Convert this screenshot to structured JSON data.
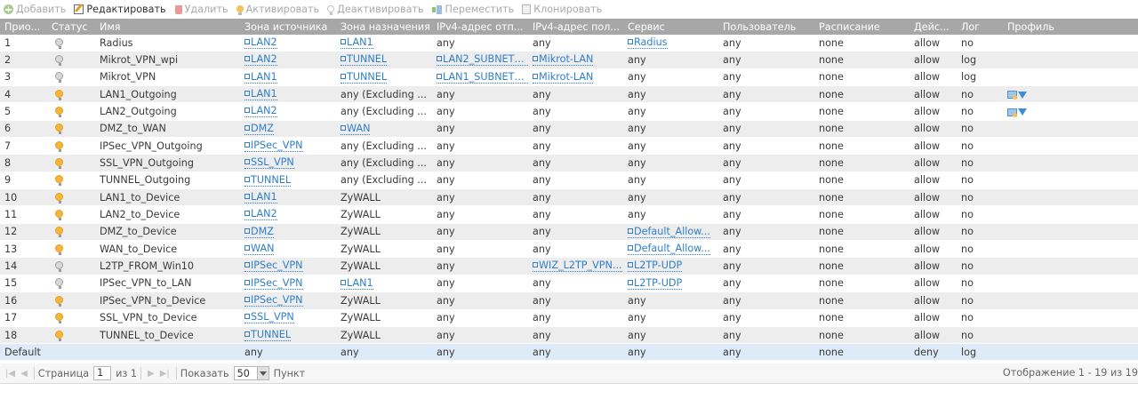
{
  "toolbar": {
    "add": "Добавить",
    "edit": "Редактировать",
    "delete": "Удалить",
    "activate": "Активировать",
    "deactivate": "Деактивировать",
    "move": "Переместить",
    "clone": "Клонировать"
  },
  "table": {
    "headers": [
      "Прио...",
      "Статус",
      "Имя",
      "Зона источника",
      "Зона назначения",
      "IPv4-адрес отп...",
      "IPv4-адрес пол...",
      "Сервис",
      "Пользователь",
      "Расписание",
      "Дейс...",
      "Лог",
      "Профиль"
    ],
    "rows": [
      {
        "prio": "1",
        "status": "off",
        "name": "Radius",
        "src": "LAN2",
        "src_link": true,
        "dst": "LAN1",
        "dst_link": true,
        "v4src": "any",
        "v4src_link": false,
        "v4dst": "any",
        "v4dst_link": false,
        "svc": "Radius",
        "svc_link": true,
        "user": "any",
        "sched": "none",
        "action": "allow",
        "log": "no",
        "profile": false
      },
      {
        "prio": "2",
        "status": "off",
        "name": "Mikrot_VPN_wpi",
        "src": "LAN2",
        "src_link": true,
        "dst": "TUNNEL",
        "dst_link": true,
        "v4src": "LAN2_SUBNET_...",
        "v4src_link": true,
        "v4dst": "Mikrot-LAN",
        "v4dst_link": true,
        "svc": "any",
        "svc_link": false,
        "user": "any",
        "sched": "none",
        "action": "allow",
        "log": "log",
        "profile": false
      },
      {
        "prio": "3",
        "status": "off",
        "name": "Mikrot_VPN",
        "src": "LAN1",
        "src_link": true,
        "dst": "TUNNEL",
        "dst_link": true,
        "v4src": "LAN1_SUBNET_...",
        "v4src_link": true,
        "v4dst": "Mikrot-LAN",
        "v4dst_link": true,
        "svc": "any",
        "svc_link": false,
        "user": "any",
        "sched": "none",
        "action": "allow",
        "log": "log",
        "profile": false
      },
      {
        "prio": "4",
        "status": "on",
        "name": "LAN1_Outgoing",
        "src": "LAN1",
        "src_link": true,
        "dst": "any (Excluding ...",
        "dst_link": false,
        "v4src": "any",
        "v4src_link": false,
        "v4dst": "any",
        "v4dst_link": false,
        "svc": "any",
        "svc_link": false,
        "user": "any",
        "sched": "none",
        "action": "allow",
        "log": "no",
        "profile": true
      },
      {
        "prio": "5",
        "status": "on",
        "name": "LAN2_Outgoing",
        "src": "LAN2",
        "src_link": true,
        "dst": "any (Excluding ...",
        "dst_link": false,
        "v4src": "any",
        "v4src_link": false,
        "v4dst": "any",
        "v4dst_link": false,
        "svc": "any",
        "svc_link": false,
        "user": "any",
        "sched": "none",
        "action": "allow",
        "log": "no",
        "profile": true
      },
      {
        "prio": "6",
        "status": "on",
        "name": "DMZ_to_WAN",
        "src": "DMZ",
        "src_link": true,
        "dst": "WAN",
        "dst_link": true,
        "v4src": "any",
        "v4src_link": false,
        "v4dst": "any",
        "v4dst_link": false,
        "svc": "any",
        "svc_link": false,
        "user": "any",
        "sched": "none",
        "action": "allow",
        "log": "no",
        "profile": false
      },
      {
        "prio": "7",
        "status": "on",
        "name": "IPSec_VPN_Outgoing",
        "src": "IPSec_VPN",
        "src_link": true,
        "dst": "any (Excluding ...",
        "dst_link": false,
        "v4src": "any",
        "v4src_link": false,
        "v4dst": "any",
        "v4dst_link": false,
        "svc": "any",
        "svc_link": false,
        "user": "any",
        "sched": "none",
        "action": "allow",
        "log": "no",
        "profile": false
      },
      {
        "prio": "8",
        "status": "on",
        "name": "SSL_VPN_Outgoing",
        "src": "SSL_VPN",
        "src_link": true,
        "dst": "any (Excluding ...",
        "dst_link": false,
        "v4src": "any",
        "v4src_link": false,
        "v4dst": "any",
        "v4dst_link": false,
        "svc": "any",
        "svc_link": false,
        "user": "any",
        "sched": "none",
        "action": "allow",
        "log": "no",
        "profile": false
      },
      {
        "prio": "9",
        "status": "on",
        "name": "TUNNEL_Outgoing",
        "src": "TUNNEL",
        "src_link": true,
        "dst": "any (Excluding ...",
        "dst_link": false,
        "v4src": "any",
        "v4src_link": false,
        "v4dst": "any",
        "v4dst_link": false,
        "svc": "any",
        "svc_link": false,
        "user": "any",
        "sched": "none",
        "action": "allow",
        "log": "no",
        "profile": false
      },
      {
        "prio": "10",
        "status": "on",
        "name": "LAN1_to_Device",
        "src": "LAN1",
        "src_link": true,
        "dst": "ZyWALL",
        "dst_link": false,
        "v4src": "any",
        "v4src_link": false,
        "v4dst": "any",
        "v4dst_link": false,
        "svc": "any",
        "svc_link": false,
        "user": "any",
        "sched": "none",
        "action": "allow",
        "log": "no",
        "profile": false
      },
      {
        "prio": "11",
        "status": "on",
        "name": "LAN2_to_Device",
        "src": "LAN2",
        "src_link": true,
        "dst": "ZyWALL",
        "dst_link": false,
        "v4src": "any",
        "v4src_link": false,
        "v4dst": "any",
        "v4dst_link": false,
        "svc": "any",
        "svc_link": false,
        "user": "any",
        "sched": "none",
        "action": "allow",
        "log": "no",
        "profile": false
      },
      {
        "prio": "12",
        "status": "on",
        "name": "DMZ_to_Device",
        "src": "DMZ",
        "src_link": true,
        "dst": "ZyWALL",
        "dst_link": false,
        "v4src": "any",
        "v4src_link": false,
        "v4dst": "any",
        "v4dst_link": false,
        "svc": "Default_Allow...",
        "svc_link": true,
        "user": "any",
        "sched": "none",
        "action": "allow",
        "log": "no",
        "profile": false
      },
      {
        "prio": "13",
        "status": "on",
        "name": "WAN_to_Device",
        "src": "WAN",
        "src_link": true,
        "dst": "ZyWALL",
        "dst_link": false,
        "v4src": "any",
        "v4src_link": false,
        "v4dst": "any",
        "v4dst_link": false,
        "svc": "Default_Allow...",
        "svc_link": true,
        "user": "any",
        "sched": "none",
        "action": "allow",
        "log": "no",
        "profile": false
      },
      {
        "prio": "14",
        "status": "off",
        "name": "L2TP_FROM_Win10",
        "src": "IPSec_VPN",
        "src_link": true,
        "dst": "ZyWALL",
        "dst_link": false,
        "v4src": "any",
        "v4src_link": false,
        "v4dst": "WIZ_L2TP_VPN...",
        "v4dst_link": true,
        "svc": "L2TP-UDP",
        "svc_link": true,
        "user": "any",
        "sched": "none",
        "action": "allow",
        "log": "no",
        "profile": false
      },
      {
        "prio": "15",
        "status": "off",
        "name": "IPSec_VPN_to_LAN",
        "src": "IPSec_VPN",
        "src_link": true,
        "dst": "LAN1",
        "dst_link": true,
        "v4src": "any",
        "v4src_link": false,
        "v4dst": "any",
        "v4dst_link": false,
        "svc": "L2TP-UDP",
        "svc_link": true,
        "user": "any",
        "sched": "none",
        "action": "allow",
        "log": "no",
        "profile": false
      },
      {
        "prio": "16",
        "status": "on",
        "name": "IPSec_VPN_to_Device",
        "src": "IPSec_VPN",
        "src_link": true,
        "dst": "ZyWALL",
        "dst_link": false,
        "v4src": "any",
        "v4src_link": false,
        "v4dst": "any",
        "v4dst_link": false,
        "svc": "any",
        "svc_link": false,
        "user": "any",
        "sched": "none",
        "action": "allow",
        "log": "no",
        "profile": false
      },
      {
        "prio": "17",
        "status": "on",
        "name": "SSL_VPN_to_Device",
        "src": "SSL_VPN",
        "src_link": true,
        "dst": "ZyWALL",
        "dst_link": false,
        "v4src": "any",
        "v4src_link": false,
        "v4dst": "any",
        "v4dst_link": false,
        "svc": "any",
        "svc_link": false,
        "user": "any",
        "sched": "none",
        "action": "allow",
        "log": "no",
        "profile": false
      },
      {
        "prio": "18",
        "status": "on",
        "name": "TUNNEL_to_Device",
        "src": "TUNNEL",
        "src_link": true,
        "dst": "ZyWALL",
        "dst_link": false,
        "v4src": "any",
        "v4src_link": false,
        "v4dst": "any",
        "v4dst_link": false,
        "svc": "any",
        "svc_link": false,
        "user": "any",
        "sched": "none",
        "action": "allow",
        "log": "no",
        "profile": false
      }
    ],
    "default_row": {
      "label": "Default",
      "src": "any",
      "dst": "any",
      "v4src": "any",
      "v4dst": "any",
      "svc": "any",
      "user": "any",
      "sched": "none",
      "action": "deny",
      "log": "log"
    }
  },
  "pager": {
    "page_label": "Страница",
    "page_value": "1",
    "of_label": "из 1",
    "show_label": "Показать",
    "show_value": "50",
    "items_label": "Пункт",
    "display_text": "Отображение 1 - 19 из 19"
  },
  "colors": {
    "header_bg": "#a7a7a7",
    "link": "#2f7ec9",
    "default_row_bg": "#dcebf7",
    "bulb_on": "#f6b63a"
  }
}
